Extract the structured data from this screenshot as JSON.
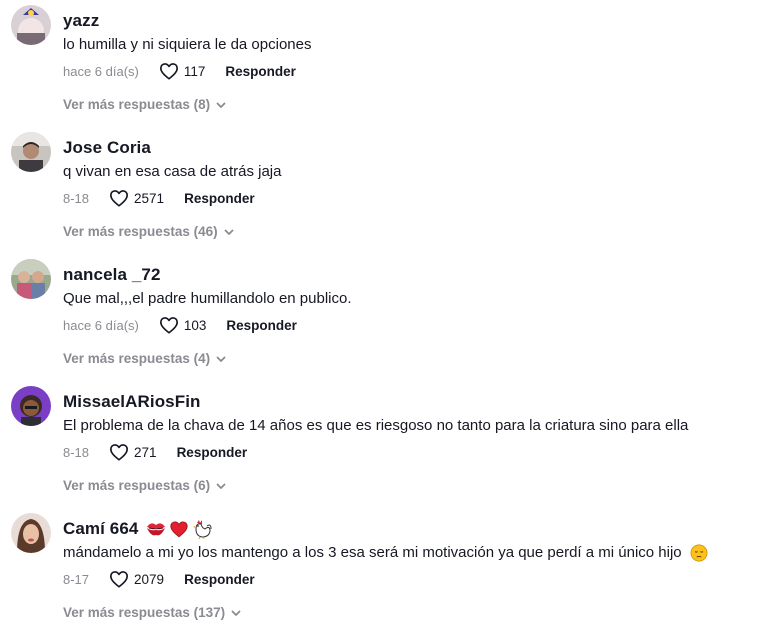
{
  "comments": [
    {
      "username": "yazz",
      "text": "lo humilla y ni siquiera le da opciones",
      "date": "hace 6 día(s)",
      "likes": "117",
      "reply": "Responder",
      "more_replies": "Ver más respuestas (8)",
      "avatar_icon": "avatar-icon"
    },
    {
      "username": "Jose Coria",
      "text": "q vivan en esa casa de atrás jaja",
      "date": "8-18",
      "likes": "2571",
      "reply": "Responder",
      "more_replies": "Ver más respuestas (46)",
      "avatar_icon": "avatar-icon"
    },
    {
      "username": "nancela _72",
      "text": "Que mal,,,el padre humillandolo en publico.",
      "date": "hace 6 día(s)",
      "likes": "103",
      "reply": "Responder",
      "more_replies": "Ver más respuestas (4)",
      "avatar_icon": "avatar-icon"
    },
    {
      "username": "MissaelARiosFin",
      "text": "El problema de la chava de 14 años es que es riesgoso no tanto para la criatura sino para ella",
      "date": "8-18",
      "likes": "271",
      "reply": "Responder",
      "more_replies": "Ver más respuestas (6)",
      "avatar_icon": "avatar-icon"
    },
    {
      "username": "Camí 664",
      "username_emojis": [
        "kiss-mark-icon",
        "red-heart-icon",
        "rooster-icon"
      ],
      "text": "mándamelo a mi yo los mantengo a los 3 esa será mi motivación ya que perdí a mi único hijo",
      "text_emoji": "pensive-face-icon",
      "date": "8-17",
      "likes": "2079",
      "reply": "Responder",
      "more_replies": "Ver más respuestas (137)",
      "avatar_icon": "avatar-icon"
    }
  ],
  "colors": {
    "primary_text": "#161823",
    "secondary_text": "#8a8b91",
    "background": "#ffffff"
  }
}
